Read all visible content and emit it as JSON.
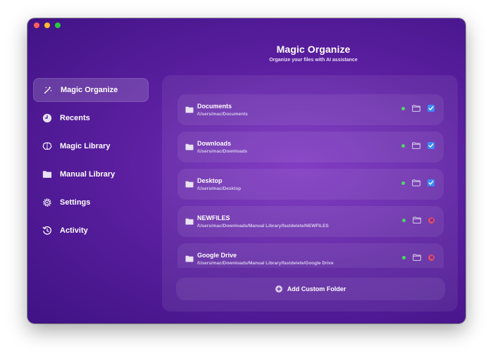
{
  "header": {
    "title": "Magic Organize",
    "subtitle": "Organize your files with AI assistance"
  },
  "sidebar": {
    "items": [
      {
        "label": "Magic Organize",
        "icon": "magic-wand-icon",
        "active": true
      },
      {
        "label": "Recents",
        "icon": "clock-icon",
        "active": false
      },
      {
        "label": "Magic Library",
        "icon": "brain-icon",
        "active": false
      },
      {
        "label": "Manual Library",
        "icon": "folder-icon",
        "active": false
      },
      {
        "label": "Settings",
        "icon": "gear-icon",
        "active": false
      },
      {
        "label": "Activity",
        "icon": "history-icon",
        "active": false
      }
    ]
  },
  "folders": [
    {
      "name": "Documents",
      "path": "/Users/mac/Documents",
      "status": "active",
      "action": "checked"
    },
    {
      "name": "Downloads",
      "path": "/Users/mac/Downloads",
      "status": "active",
      "action": "checked"
    },
    {
      "name": "Desktop",
      "path": "/Users/mac/Desktop",
      "status": "active",
      "action": "checked"
    },
    {
      "name": "NEWFILES",
      "path": "/Users/mac/Downloads/Manual Library/fastdelete/NEWFILES",
      "status": "active",
      "action": "remove"
    },
    {
      "name": "Google Drive",
      "path": "/Users/mac/Downloads/Manual Library/fastdelete/Google Drive",
      "status": "active",
      "action": "remove"
    }
  ],
  "add_button": {
    "label": "Add Custom Folder"
  },
  "colors": {
    "accent": "#3d8af7",
    "status_active": "#4cd964",
    "remove": "#e0506a",
    "background": "#5b1fa0"
  }
}
